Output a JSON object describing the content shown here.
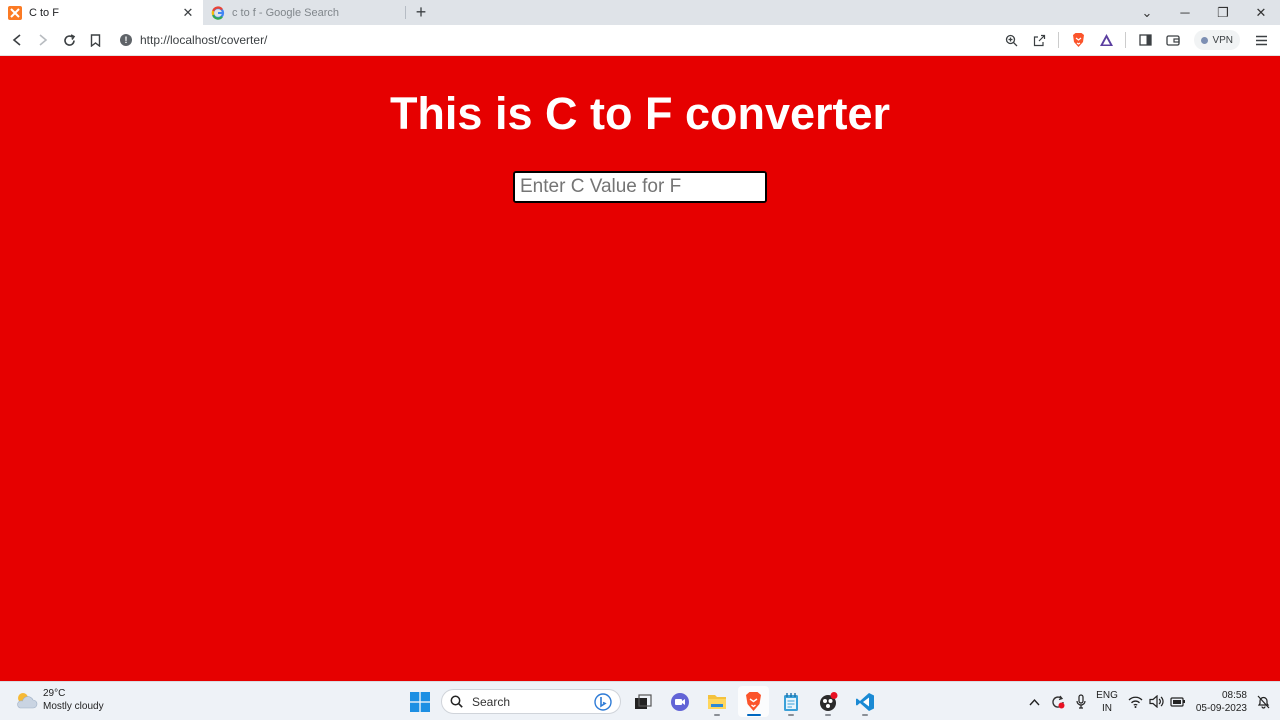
{
  "browser": {
    "tabs": [
      {
        "title": "C to F",
        "active": true,
        "favicon": "xampp-icon"
      },
      {
        "title": "c to f - Google Search",
        "active": false,
        "favicon": "google-icon"
      }
    ],
    "url": "http://localhost/coverter/",
    "vpn_label": "VPN"
  },
  "page": {
    "background": "#e60000",
    "heading": "This is C to F converter",
    "input_placeholder": "Enter C Value for F",
    "input_value": ""
  },
  "taskbar": {
    "weather_temp": "29°C",
    "weather_desc": "Mostly cloudy",
    "search_label": "Search",
    "lang_line1": "ENG",
    "lang_line2": "IN",
    "time": "08:58",
    "date": "05-09-2023"
  }
}
